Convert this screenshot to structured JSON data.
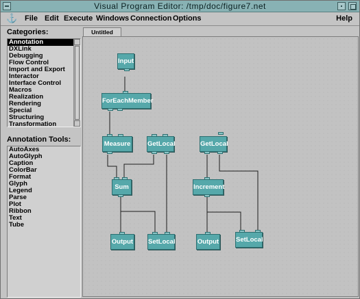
{
  "window": {
    "title": "Visual Program Editor: /tmp/doc/figure7.net"
  },
  "menubar": {
    "anchor": "⚓",
    "items": [
      "File",
      "Edit",
      "Execute",
      "Windows",
      "Connection",
      "Options"
    ],
    "help": "Help"
  },
  "categories": {
    "label": "Categories:",
    "items": [
      "Annotation",
      "DXLink",
      "Debugging",
      "Flow Control",
      "Import and Export",
      "Interactor",
      "Interface Control",
      "Macros",
      "Realization",
      "Rendering",
      "Special",
      "Structuring",
      "Transformation"
    ],
    "selected": "Annotation"
  },
  "tools": {
    "label": "Annotation Tools:",
    "items": [
      "AutoAxes",
      "AutoGlyph",
      "Caption",
      "ColorBar",
      "Format",
      "Glyph",
      "Legend",
      "Parse",
      "Plot",
      "Ribbon",
      "Text",
      "Tube"
    ]
  },
  "editor": {
    "tab_label": "Untitled"
  },
  "nodes": {
    "input": "Input",
    "foreach": "ForEachMember",
    "measure": "Measure",
    "getlocal1": "GetLocal",
    "getlocal2": "GetLocal",
    "sum": "Sum",
    "increment": "Increment",
    "output1": "Output",
    "setlocal1": "SetLocal",
    "output2": "Output",
    "setlocal2": "SetLocal"
  },
  "colors": {
    "titlebar": "#88b2b4",
    "node_fill": "#56a8aa",
    "wire": "#1c1c1c"
  }
}
